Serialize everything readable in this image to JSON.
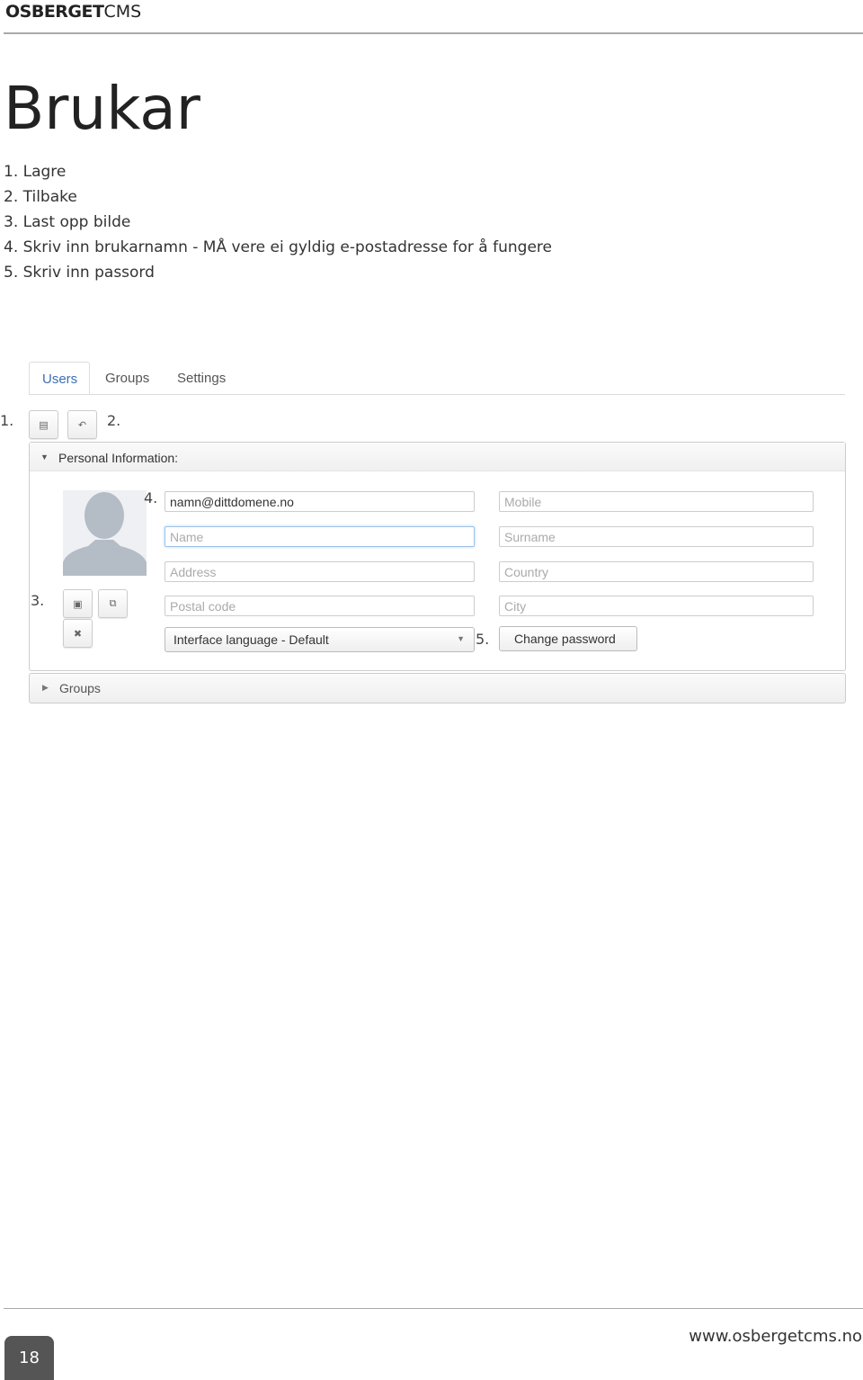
{
  "header": {
    "logo_bold": "OSBERGET",
    "logo_light": "CMS"
  },
  "title": "Brukar",
  "steps": [
    "1. Lagre",
    "2. Tilbake",
    "3. Last opp bilde",
    "4. Skriv inn brukarnamn - MÅ vere ei gyldig e-postadresse for å fungere",
    "5. Skriv inn passord"
  ],
  "screenshot": {
    "tabs": [
      "Users",
      "Groups",
      "Settings"
    ],
    "active_tab": "Users",
    "markers": [
      "1.",
      "2.",
      "3.",
      "4.",
      "5."
    ],
    "panel_title": "Personal Information:",
    "fields": {
      "username": "namn@dittdomene.no",
      "name": "Name",
      "address": "Address",
      "postal_code": "Postal code",
      "mobile": "Mobile",
      "surname": "Surname",
      "country": "Country",
      "city": "City"
    },
    "language_select": "Interface language - Default",
    "change_password": "Change password",
    "groups_panel": "Groups"
  },
  "footer": {
    "page_number": "18",
    "url": "www.osbergetcms.no"
  }
}
